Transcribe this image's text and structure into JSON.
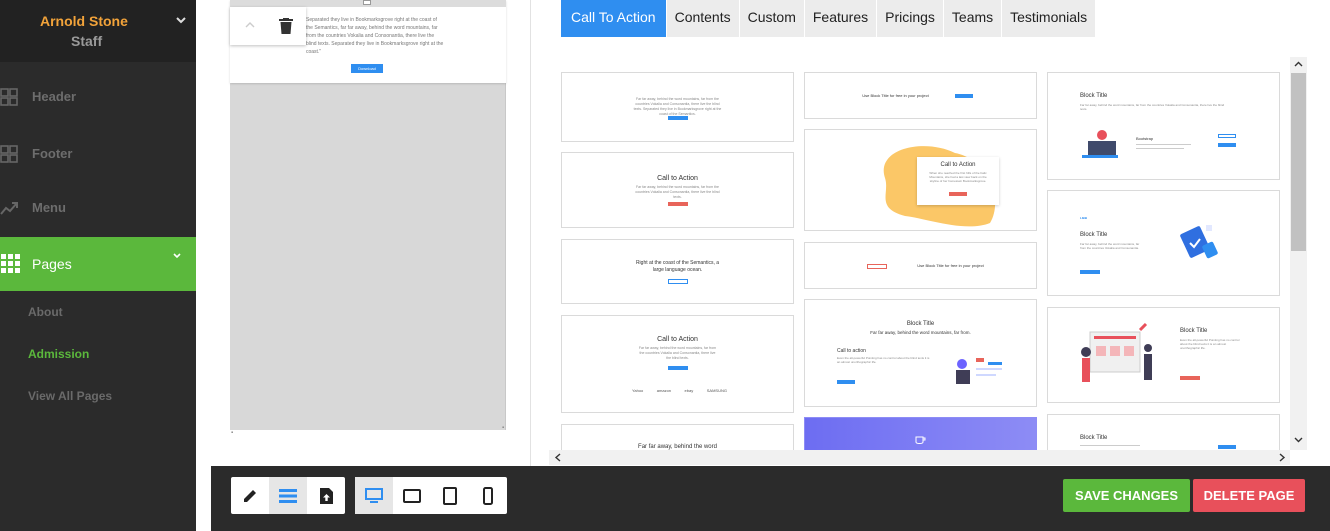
{
  "user": {
    "name": "Arnold Stone",
    "role": "Staff"
  },
  "nav": {
    "items": [
      {
        "label": "Header",
        "icon": "grid-icon"
      },
      {
        "label": "Footer",
        "icon": "grid-icon"
      },
      {
        "label": "Menu",
        "icon": "trend-icon"
      },
      {
        "label": "Pages",
        "icon": "apps-icon",
        "active": true
      }
    ],
    "sub_items": [
      {
        "label": "About"
      },
      {
        "label": "Admission",
        "current": true
      },
      {
        "label": "View All Pages"
      }
    ]
  },
  "canvas": {
    "block_text": "Separated they live in Bookmarksgrove right at the coast of the Semantics, far far away, behind the word mountains, far from the countries Vokalia and Consonantia, there live the blind texts. Separated they live in Bookmarksgrove right at the coast.\"",
    "block_button": "Download"
  },
  "tabs": [
    "Call To Action",
    "Contents",
    "Custom",
    "Features",
    "Pricings",
    "Teams",
    "Testimonials"
  ],
  "gallery": {
    "col1": [
      {
        "title": "",
        "small": "Far far away, behind the word mountains, far from the countries Vokalia and Consonantia, there live the blind texts. Separated they live in Bookmarksgrove right at the coast of the Semantics."
      },
      {
        "title": "Call to Action",
        "small": "Far far away, behind the word mountains, far from the countries Vokalia and Consonantia, there live the blind texts."
      },
      {
        "title": "Right at the coast of the Semantics, a large language ocean.",
        "small": ""
      },
      {
        "title": "Call to Action",
        "small": "Far far away, behind the word mountains, far from the countries Vokalia and Consonantia, there live the blind texts.",
        "logos": [
          "Yahoo",
          "amazon",
          "ebay",
          "SAMSUNG"
        ]
      },
      {
        "title": "Far far away, behind the word",
        "small": ""
      }
    ],
    "col2": [
      {
        "title": "Use Block Title for free in your project"
      },
      {
        "title": "Call to Action",
        "small": "When she reached the first hills of the Italic Mountains, she had a last view back on the skyline of her hometown Bookmarksgrove."
      },
      {
        "title": "Use Block Title for free in your project"
      },
      {
        "title": "Block Title",
        "subtitle": "Far far away, behind the word mountains, far from.",
        "inner": "Call to action",
        "small": "Even the all-powerful Pointing has no control about the blind texts it is an almost unorthographic life."
      }
    ],
    "col3": [
      {
        "title": "Block Title",
        "small": "Far far away, behind the word mountains, far from the countries Vokalia and Consonantia, there live the blind texts.",
        "inner": "Bootstrap"
      },
      {
        "title": "Block Title",
        "tag": "LIBB",
        "small": "Far far away, behind the word mountains, far from the countries Vokalia and Consonantia."
      },
      {
        "title": "Block Title",
        "small": "Even the all-powerful Pointing has no control about the blind texts it is an almost unorthographic life."
      },
      {
        "title": "Block Title"
      }
    ]
  },
  "toolbar": {
    "save_label": "SAVE CHANGES",
    "delete_label": "DELETE PAGE"
  },
  "colors": {
    "accent": "#2f8ef0",
    "active_nav": "#5bb83c",
    "user_name": "#f2a33a",
    "delete": "#e8505b"
  }
}
